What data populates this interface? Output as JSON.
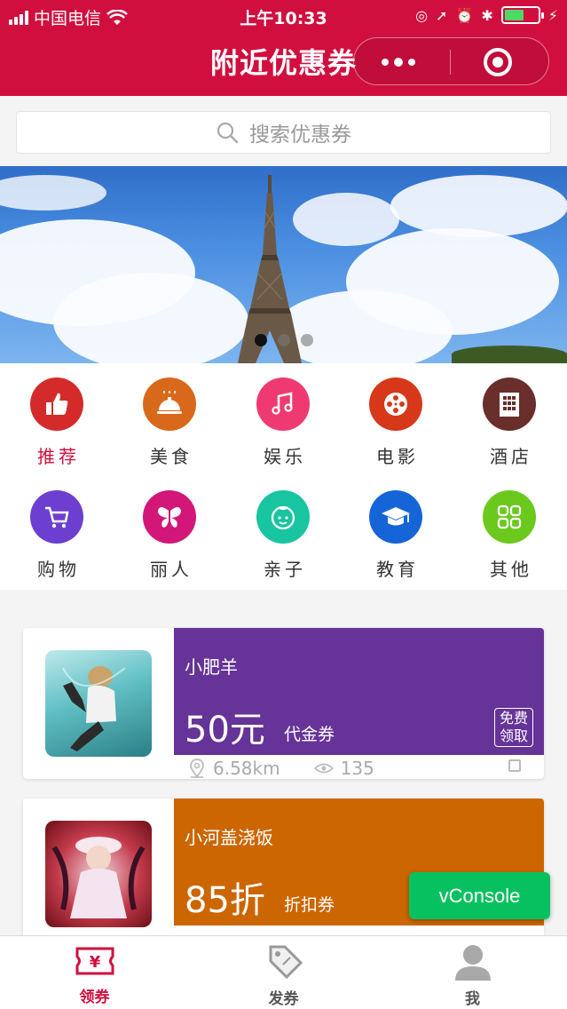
{
  "status_bar": {
    "carrier": "中国电信",
    "time": "上午10:33",
    "battery_color": "#4cd964"
  },
  "nav": {
    "title": "附近优惠券",
    "more_icon": "more-dots-icon",
    "close_icon": "target-circle-icon",
    "bg_color": "#d10f3f"
  },
  "search": {
    "placeholder": "搜索优惠券"
  },
  "banner": {
    "slide_count": 3,
    "active_index": 0
  },
  "categories": [
    {
      "label": "推荐",
      "icon": "thumbs-up-icon",
      "color": "#d52a2a",
      "active": true
    },
    {
      "label": "美食",
      "icon": "food-cloche-icon",
      "color": "#d9691a",
      "active": false
    },
    {
      "label": "娱乐",
      "icon": "music-note-icon",
      "color": "#ef3a71",
      "active": false
    },
    {
      "label": "电影",
      "icon": "film-reel-icon",
      "color": "#d8381a",
      "active": false
    },
    {
      "label": "酒店",
      "icon": "hotel-building-icon",
      "color": "#6a2f2a",
      "active": false
    },
    {
      "label": "购物",
      "icon": "shopping-cart-icon",
      "color": "#6c3fd0",
      "active": false
    },
    {
      "label": "丽人",
      "icon": "butterfly-icon",
      "color": "#d21779",
      "active": false
    },
    {
      "label": "亲子",
      "icon": "baby-face-icon",
      "color": "#19c4a0",
      "active": false
    },
    {
      "label": "教育",
      "icon": "graduation-cap-icon",
      "color": "#1565d8",
      "active": false
    },
    {
      "label": "其他",
      "icon": "grid-icon",
      "color": "#6bc91e",
      "active": false
    }
  ],
  "coupons": [
    {
      "shop": "小肥羊",
      "amount": "50元",
      "type": "代金券",
      "badge_line1": "免费",
      "badge_line2": "领取",
      "distance": "6.58km",
      "views": "135",
      "color": "#663398"
    },
    {
      "shop": "小河盖浇饭",
      "amount": "85折",
      "type": "折扣券",
      "distance": "",
      "views": "",
      "color": "#cc6600"
    }
  ],
  "tabbar": [
    {
      "label": "领券",
      "icon": "coupon-yen-icon",
      "active": true
    },
    {
      "label": "发券",
      "icon": "price-tag-icon",
      "active": false
    },
    {
      "label": "我",
      "icon": "user-avatar-icon",
      "active": false
    }
  ],
  "vconsole": {
    "label": "vConsole",
    "color": "#07c160"
  }
}
